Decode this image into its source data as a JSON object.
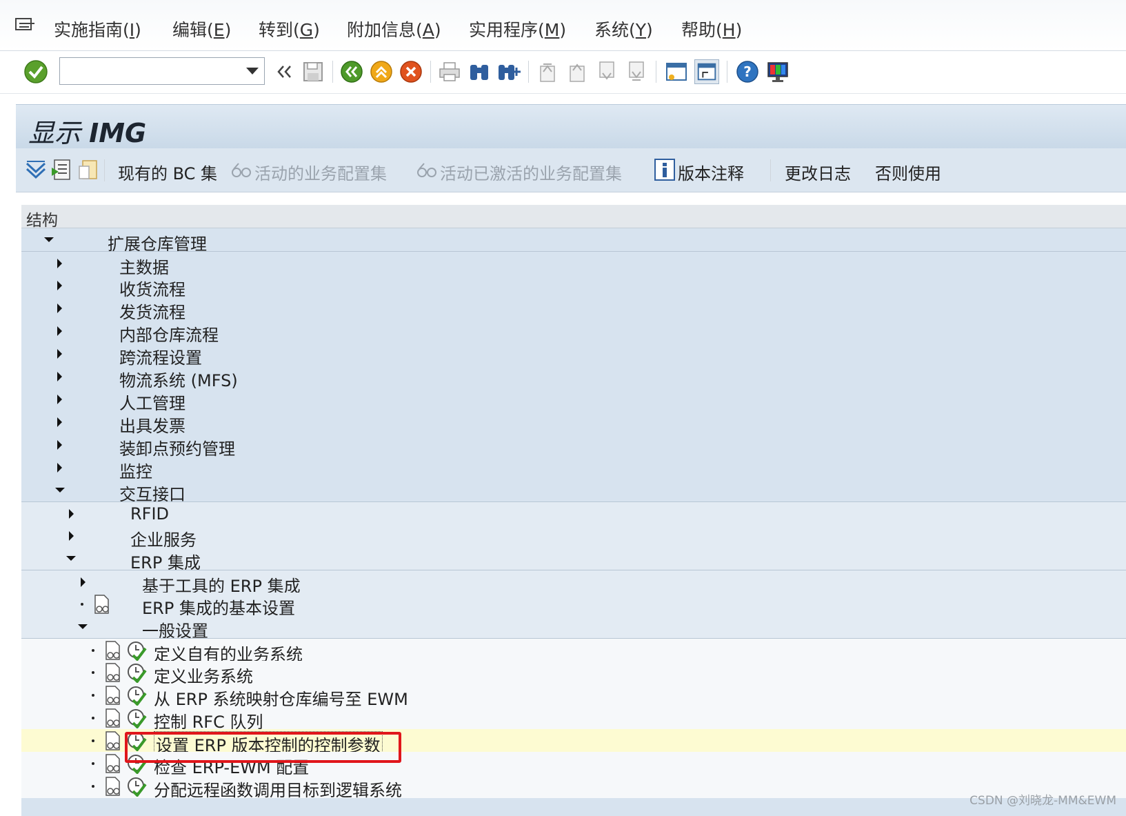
{
  "menubar": {
    "items": [
      {
        "label": "实施指南(",
        "key": "I",
        "tail": ")"
      },
      {
        "label": "编辑(",
        "key": "E",
        "tail": ")"
      },
      {
        "label": "转到(",
        "key": "G",
        "tail": ")"
      },
      {
        "label": "附加信息(",
        "key": "A",
        "tail": ")"
      },
      {
        "label": "实用程序(",
        "key": "M",
        "tail": ")"
      },
      {
        "label": "系统(",
        "key": "Y",
        "tail": ")"
      },
      {
        "label": "帮助(",
        "key": "H",
        "tail": ")"
      }
    ]
  },
  "toolbar": {
    "command_value": "",
    "icons": [
      "enter-icon",
      "back-double-icon",
      "save-icon",
      "back-icon",
      "exit-icon",
      "cancel-icon",
      "print-icon",
      "find-icon",
      "find-next-icon",
      "first-page-icon",
      "prev-page-icon",
      "next-page-icon",
      "last-page-icon",
      "new-session-icon",
      "shortcut-icon",
      "help-icon",
      "layout-icon"
    ]
  },
  "title": {
    "prefix": "显示 ",
    "main": "IMG"
  },
  "app_toolbar": {
    "bc_set": "现有的 BC 集",
    "active_config": "活动的业务配置集",
    "active_activated_config": "活动已激活的业务配置集",
    "release_notes": "版本注释",
    "change_log": "更改日志",
    "else_use": "否则使用"
  },
  "tree": {
    "header": "结构",
    "root": "扩展仓库管理",
    "level1": [
      "主数据",
      "收货流程",
      "发货流程",
      "内部仓库流程",
      "跨流程设置",
      "物流系统 (MFS)",
      "人工管理",
      "出具发票",
      "装卸点预约管理",
      "监控",
      "交互接口"
    ],
    "level2": [
      "RFID",
      "企业服务",
      "ERP 集成"
    ],
    "level3": [
      "基于工具的 ERP 集成",
      "ERP 集成的基本设置",
      "一般设置"
    ],
    "level4": [
      "定义自有的业务系统",
      "定义业务系统",
      "从 ERP 系统映射仓库编号至 EWM",
      "控制 RFC 队列",
      "设置 ERP 版本控制的控制参数",
      "检查 ERP-EWM 配置",
      "分配远程函数调用目标到逻辑系统"
    ],
    "selected": "设置 ERP 版本控制的控制参数"
  },
  "watermark": "CSDN @刘晓龙-MM&EWM"
}
